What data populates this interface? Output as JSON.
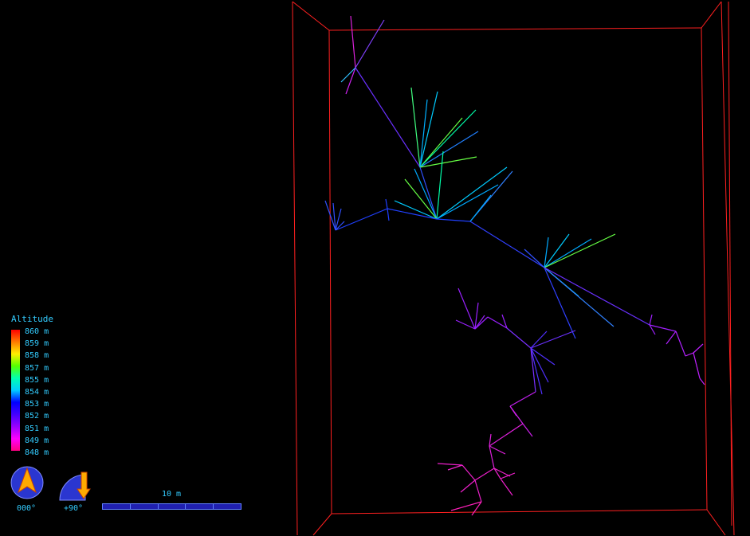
{
  "legend": {
    "title": "Altitude",
    "labels": [
      "860 m",
      "859 m",
      "858 m",
      "857 m",
      "855 m",
      "854 m",
      "853 m",
      "852 m",
      "851 m",
      "849 m",
      "848 m"
    ]
  },
  "compass": {
    "heading": "000°",
    "tilt": "+90°"
  },
  "scale": {
    "label": "10 m",
    "segments": 5
  },
  "colors": {
    "frame": "#ff2020",
    "text": "#33ccff",
    "compass_fill": "#ffaa00",
    "compass_bg": "#2a36d0"
  }
}
